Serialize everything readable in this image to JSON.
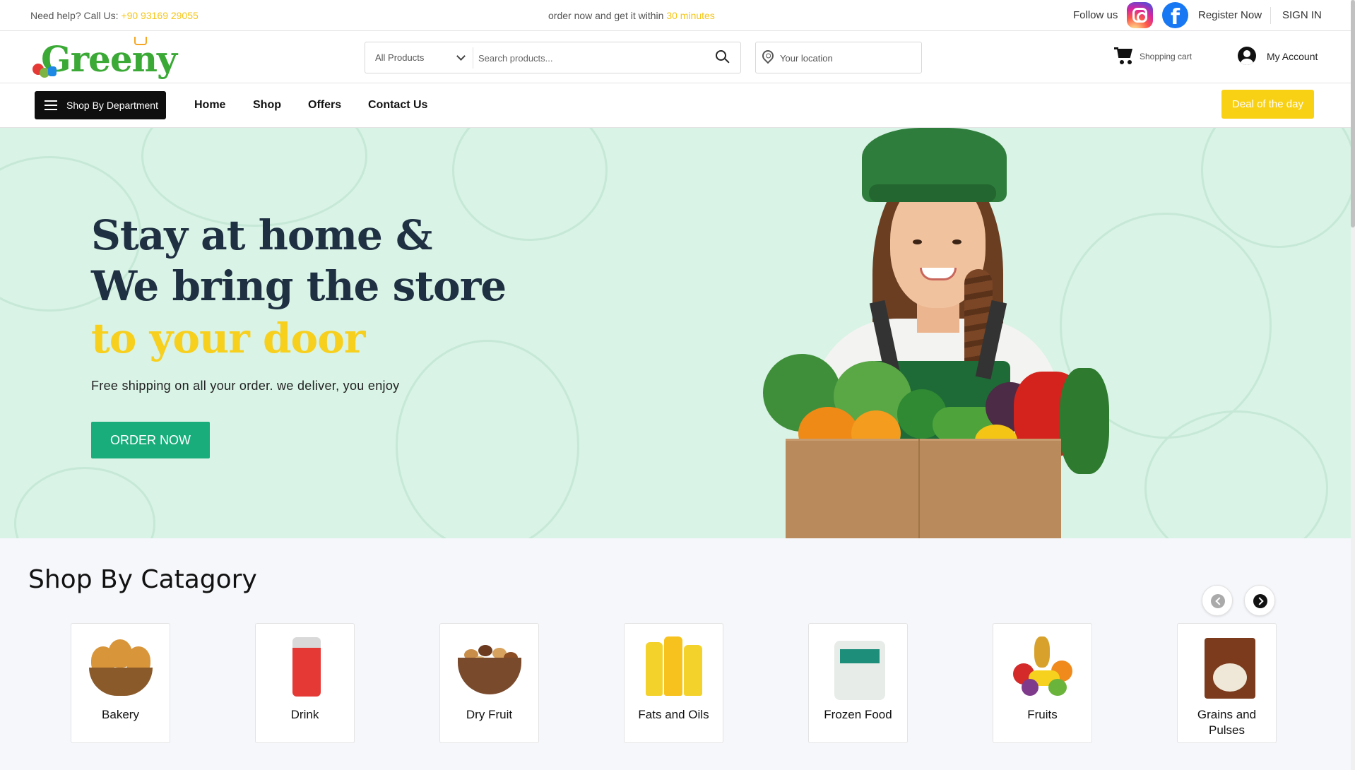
{
  "topbar": {
    "help_prefix": "Need help? Call Us: ",
    "phone": "+90 93169 29055",
    "promo_prefix": "order now and get it within ",
    "promo_minutes": "30 minutes",
    "follow_label": "Follow us",
    "register_label": "Register Now",
    "signin_label": "SIGN IN"
  },
  "header": {
    "logo_text": "Greeny",
    "search_category": "All Products",
    "search_placeholder": "Search products...",
    "location_placeholder": "Your location",
    "cart_label": "Shopping cart",
    "account_label": "My Account"
  },
  "nav": {
    "department_label": "Shop By Department",
    "links": [
      "Home",
      "Shop",
      "Offers",
      "Contact Us"
    ],
    "deal_label": "Deal of the day"
  },
  "hero": {
    "line1": "Stay at home &",
    "line2": "We bring the store",
    "line3": "to your door",
    "subtitle": "Free shipping on all your order. we deliver, you enjoy",
    "cta_label": "ORDER NOW"
  },
  "categories": {
    "title": "Shop By Catagory",
    "items": [
      {
        "label": "Bakery"
      },
      {
        "label": "Drink"
      },
      {
        "label": "Dry Fruit"
      },
      {
        "label": "Fats and Oils"
      },
      {
        "label": "Frozen Food"
      },
      {
        "label": "Fruits"
      },
      {
        "label": "Grains and Pulses"
      }
    ]
  },
  "colors": {
    "accent_yellow": "#f9d114",
    "cta_green": "#19ad7c",
    "hero_bg": "#d9f3e6",
    "heading_navy": "#1f3042"
  }
}
